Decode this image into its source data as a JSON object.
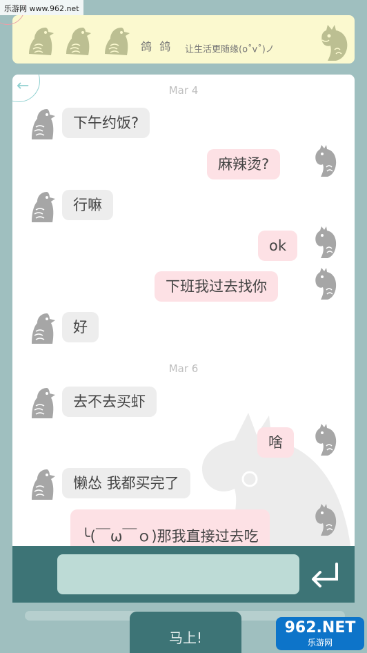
{
  "watermark": {
    "top": "乐游网 www.962.net",
    "logo": "962.NET",
    "logo_sub": "乐游网"
  },
  "header": {
    "name": "鸽 鸽",
    "status": "让生活更随缘(o˚v˚)ノ"
  },
  "messages": [
    {
      "type": "date",
      "text": "Mar 4"
    },
    {
      "side": "left",
      "text": "下午约饭?"
    },
    {
      "side": "right",
      "text": "麻辣烫?"
    },
    {
      "side": "left",
      "text": "行嘛"
    },
    {
      "side": "right",
      "text": "ok"
    },
    {
      "side": "right",
      "text": "下班我过去找你"
    },
    {
      "side": "left",
      "text": "好"
    },
    {
      "type": "date",
      "text": "Mar 6"
    },
    {
      "side": "left",
      "text": "去不去买虾"
    },
    {
      "side": "right",
      "text": "啥"
    },
    {
      "side": "left",
      "text": "懒怂 我都买完了"
    },
    {
      "side": "right",
      "text": "╰(￣ω￣ｏ)那我直接过去吃"
    }
  ],
  "input": {
    "value": "",
    "placeholder": ""
  },
  "footer": {
    "tab_label": "马上!"
  },
  "colors": {
    "header_bg": "#fbf9cf",
    "left_bubble": "#ededed",
    "right_bubble": "#fde1e5",
    "bar": "#3d7476",
    "input_bg": "#bddbd6"
  }
}
